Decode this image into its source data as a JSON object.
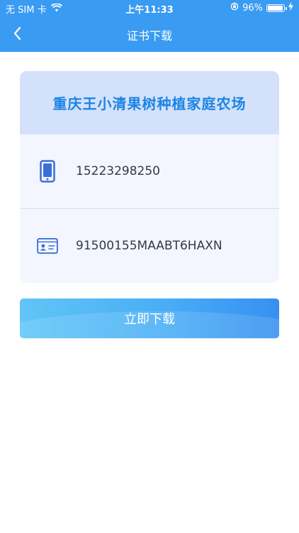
{
  "status_bar": {
    "carrier": "无 SIM 卡",
    "time": "上午11:33",
    "battery": "96%",
    "battery_level": 0.96
  },
  "nav": {
    "title": "证书下载",
    "back_icon": "chevron-left-icon"
  },
  "card": {
    "title": "重庆王小清果树种植家庭农场",
    "phone": {
      "icon": "phone-icon",
      "value": "15223298250"
    },
    "id_card": {
      "icon": "id-card-icon",
      "value": "91500155MAABT6HAXN"
    }
  },
  "download_button": {
    "label": "立即下载"
  },
  "colors": {
    "primary": "#3a9bf3",
    "title_blue": "#1a84e3",
    "card_header": "#d4e1fb",
    "card_body": "#f3f6ff",
    "icon_blue": "#3b6fd6"
  }
}
